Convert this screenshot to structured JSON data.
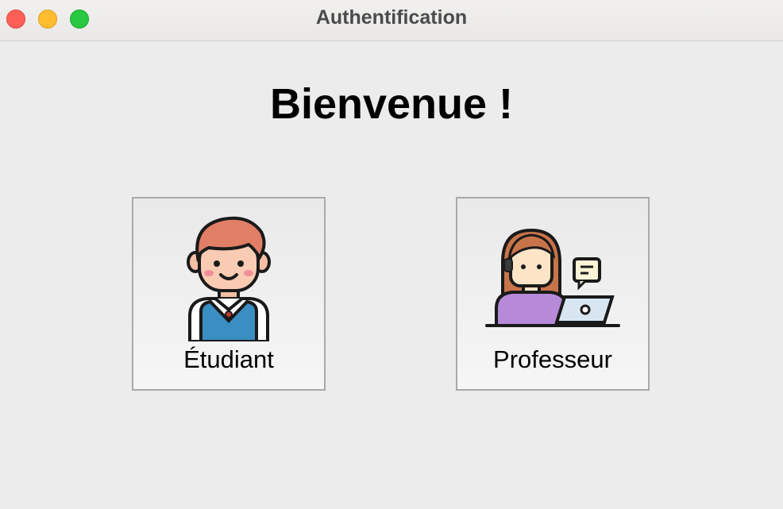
{
  "window": {
    "title": "Authentification"
  },
  "main": {
    "heading": "Bienvenue !",
    "roles": [
      {
        "label": "Étudiant",
        "icon": "student-avatar-icon"
      },
      {
        "label": "Professeur",
        "icon": "teacher-laptop-icon"
      }
    ]
  },
  "colors": {
    "close": "#fe5f57",
    "minimize": "#febc2e",
    "maximize": "#28c840",
    "background": "#ececec"
  }
}
